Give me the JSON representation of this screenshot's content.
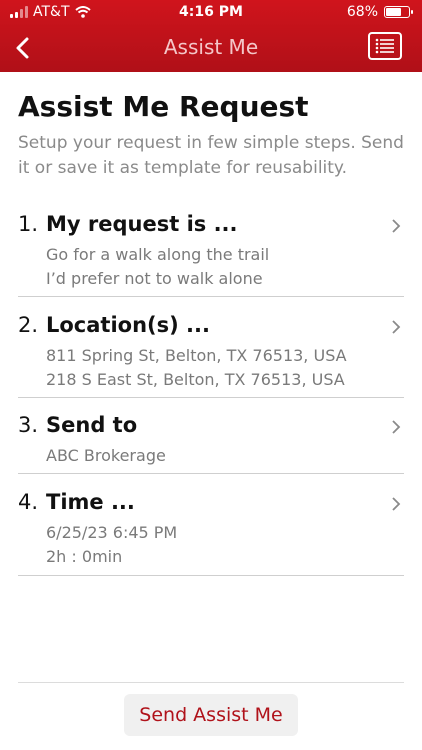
{
  "status_bar": {
    "carrier": "AT&T",
    "time": "4:16 PM",
    "battery": "68%",
    "battery_level": 0.68
  },
  "nav": {
    "title": "Assist Me"
  },
  "main": {
    "title": "Assist Me Request",
    "subtitle_line1": "Setup your request in few simple steps. Send",
    "subtitle_line2": "it or save it as template for reusability."
  },
  "steps": [
    {
      "num": "1.",
      "title": "My request is ...",
      "lines": [
        "Go for a walk along the trail",
        "I’d prefer not to walk alone"
      ]
    },
    {
      "num": "2.",
      "title": "Location(s) ...",
      "lines": [
        "811 Spring St, Belton, TX 76513, USA",
        "218 S East St, Belton, TX 76513, USA"
      ]
    },
    {
      "num": "3.",
      "title": "Send to",
      "lines": [
        "ABC Brokerage"
      ]
    },
    {
      "num": "4.",
      "title": "Time ...",
      "lines": [
        "6/25/23 6:45 PM",
        "2h : 0min"
      ]
    }
  ],
  "actions": {
    "send_label": "Send Assist Me"
  },
  "colors": {
    "header": "#c4111a",
    "accent": "#b0121a"
  }
}
